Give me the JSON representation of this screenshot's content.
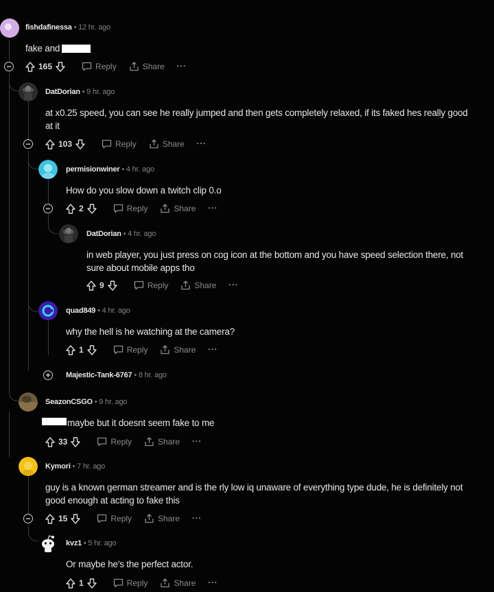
{
  "comments": [
    {
      "user": "fishdafinessa",
      "time": "• 12 hr. ago",
      "body": "fake and",
      "votes": "165",
      "reply": "Reply",
      "share": "Share",
      "more": "···"
    },
    {
      "user": "DatDorian",
      "time": "• 9 hr. ago",
      "body": "at x0.25 speed, you can see he really jumped and then gets completely relaxed, if its faked hes really good at it",
      "votes": "103",
      "reply": "Reply",
      "share": "Share",
      "more": "···"
    },
    {
      "user": "permisionwiner",
      "time": "• 4 hr. ago",
      "body": "How do you slow down a twitch clip 0.o",
      "votes": "2",
      "reply": "Reply",
      "share": "Share",
      "more": "···"
    },
    {
      "user": "DatDorian",
      "time": "• 4 hr. ago",
      "body": "in web player, you just press on cog icon at the bottom and you have speed selection there, not sure about mobile apps tho",
      "votes": "9",
      "reply": "Reply",
      "share": "Share",
      "more": "···"
    },
    {
      "user": "quad849",
      "time": "• 4 hr. ago",
      "body": "why the hell is he watching at the camera?",
      "votes": "1",
      "reply": "Reply",
      "share": "Share",
      "more": "···"
    },
    {
      "user": "Majestic-Tank-6767",
      "time": "• 8 hr. ago"
    },
    {
      "user": "SeazonCSGO",
      "time": "• 9 hr. ago",
      "body": "maybe but it doesnt seem fake to me",
      "votes": "33",
      "reply": "Reply",
      "share": "Share",
      "more": "···"
    },
    {
      "user": "Kymori",
      "time": "• 7 hr. ago",
      "body": "guy is a known german streamer and is the rly low iq unaware of everything type dude, he is definitely not good enough at acting to fake this",
      "votes": "15",
      "reply": "Reply",
      "share": "Share",
      "more": "···"
    },
    {
      "user": "kvz1",
      "time": "• 5 hr. ago",
      "body": "Or maybe he's the perfect actor.",
      "votes": "1",
      "reply": "Reply",
      "share": "Share",
      "more": "···"
    }
  ],
  "colors": {
    "background": "#040404",
    "text": "#e8e8e8",
    "muted": "#818384",
    "thread": "#3a3c3e"
  }
}
